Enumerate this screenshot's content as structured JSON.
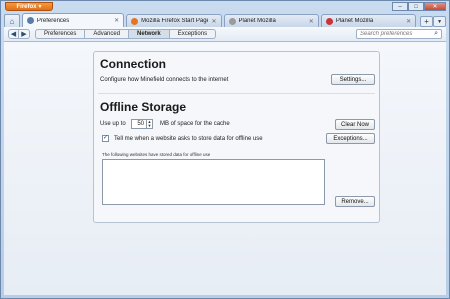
{
  "window": {
    "app_button_label": "Firefox",
    "controls": {
      "minimize": "‒",
      "maximize": "□",
      "close": "✕"
    }
  },
  "tabs": [
    {
      "label": "Preferences",
      "active": true,
      "favicon_color": "#5a7da8"
    },
    {
      "label": "Mozilla Firefox Start Page",
      "active": false,
      "favicon_color": "#e37622"
    },
    {
      "label": "Planet Mozilla",
      "active": false,
      "favicon_color": "#9a9a9a"
    },
    {
      "label": "Planet Mozilla",
      "active": false,
      "favicon_color": "#c8343a"
    }
  ],
  "nav": {
    "crumbs": [
      "Preferences",
      "Advanced",
      "Network",
      "Exceptions"
    ],
    "current_crumb": "Network",
    "search_placeholder": "Search preferences"
  },
  "connection": {
    "heading": "Connection",
    "description": "Configure how Minefield connects to the internet",
    "settings_button": "Settings..."
  },
  "offline": {
    "heading": "Offline Storage",
    "use_up_to_label": "Use up to",
    "cache_value": "50",
    "cache_suffix": "MB of space for the cache",
    "clear_now_button": "Clear Now",
    "tell_me_checked": true,
    "tell_me_label": "Tell me when a website asks to store data for offline use",
    "exceptions_button": "Exceptions...",
    "list_caption": "The following websites have stored data for offline use",
    "remove_button": "Remove..."
  },
  "colors": {
    "frame": "#b8cde6",
    "firefox_button": "#e37622",
    "panel_bg": "#f5f7fa"
  }
}
